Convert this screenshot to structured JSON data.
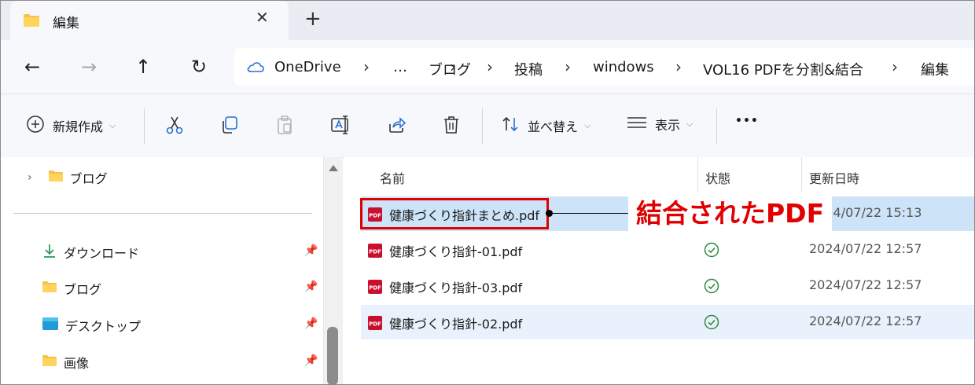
{
  "tab": {
    "title": "編集",
    "close_glyph": "✕",
    "new_tab_glyph": "+"
  },
  "nav": {
    "back": "←",
    "forward": "→",
    "up": "↑",
    "refresh": "↻"
  },
  "breadcrumb": {
    "items": [
      "OneDrive",
      "…",
      "ブログ",
      "投稿",
      "windows",
      "VOL16 PDFを分割&結合",
      "編集"
    ],
    "separator": "›"
  },
  "toolbar": {
    "new_label": "新規作成",
    "sort_label": "並べ替え",
    "view_label": "表示",
    "more_glyph": "•••"
  },
  "sidebar": {
    "top_item": "ブログ",
    "items": [
      {
        "label": "ダウンロード",
        "icon": "download-icon"
      },
      {
        "label": "ブログ",
        "icon": "folder-icon"
      },
      {
        "label": "デスクトップ",
        "icon": "desktop-icon"
      },
      {
        "label": "画像",
        "icon": "folder-icon"
      }
    ]
  },
  "columns": {
    "name": "名前",
    "status": "状態",
    "modified": "更新日時"
  },
  "files": [
    {
      "name": "健康づくり指針まとめ.pdf",
      "modified": "2024/07/22 15:13",
      "synced": false,
      "state": "selected"
    },
    {
      "name": "健康づくり指針-01.pdf",
      "modified": "2024/07/22 12:57",
      "synced": true,
      "state": "normal"
    },
    {
      "name": "健康づくり指針-03.pdf",
      "modified": "2024/07/22 12:57",
      "synced": true,
      "state": "normal"
    },
    {
      "name": "健康づくり指針-02.pdf",
      "modified": "2024/07/22 12:57",
      "synced": true,
      "state": "hover"
    }
  ],
  "annotation": {
    "text": "結合されたPDF",
    "color": "#e00000"
  },
  "colors": {
    "selected_row": "#cce3f8",
    "hover_row": "#e9f2fc",
    "folder": "#f4c24d",
    "sync_ok": "#2e8b3c",
    "pdf_red": "#c8102e",
    "onedrive": "#2b6fd1"
  }
}
